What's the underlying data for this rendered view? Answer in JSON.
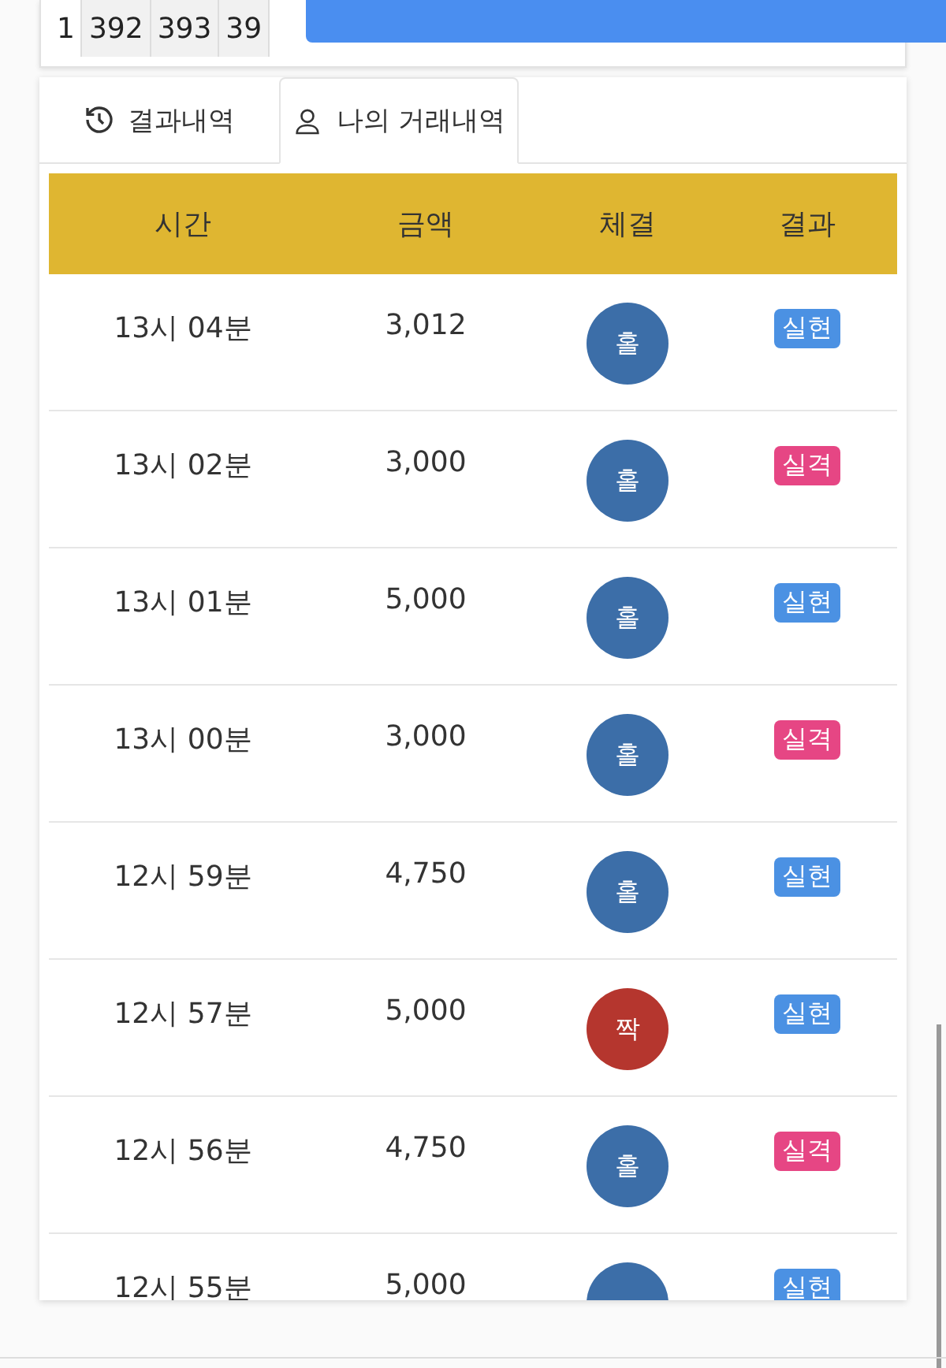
{
  "number_strip": [
    "1",
    "392",
    "393",
    "39"
  ],
  "tabs": [
    {
      "label": "결과내역",
      "selected": false
    },
    {
      "label": "나의 거래내역",
      "selected": true
    }
  ],
  "table": {
    "columns": [
      "시간",
      "금액",
      "체결",
      "결과"
    ],
    "rows": [
      {
        "time": "13시 04분",
        "amount": "3,012",
        "ball": {
          "label": "홀",
          "kind": "odd"
        },
        "result": {
          "label": "실현",
          "kind": "win"
        }
      },
      {
        "time": "13시 02분",
        "amount": "3,000",
        "ball": {
          "label": "홀",
          "kind": "odd"
        },
        "result": {
          "label": "실격",
          "kind": "lose"
        }
      },
      {
        "time": "13시 01분",
        "amount": "5,000",
        "ball": {
          "label": "홀",
          "kind": "odd"
        },
        "result": {
          "label": "실현",
          "kind": "win"
        }
      },
      {
        "time": "13시 00분",
        "amount": "3,000",
        "ball": {
          "label": "홀",
          "kind": "odd"
        },
        "result": {
          "label": "실격",
          "kind": "lose"
        }
      },
      {
        "time": "12시 59분",
        "amount": "4,750",
        "ball": {
          "label": "홀",
          "kind": "odd"
        },
        "result": {
          "label": "실현",
          "kind": "win"
        }
      },
      {
        "time": "12시 57분",
        "amount": "5,000",
        "ball": {
          "label": "짝",
          "kind": "even"
        },
        "result": {
          "label": "실현",
          "kind": "win"
        }
      },
      {
        "time": "12시 56분",
        "amount": "4,750",
        "ball": {
          "label": "홀",
          "kind": "odd"
        },
        "result": {
          "label": "실격",
          "kind": "lose"
        }
      },
      {
        "time": "12시 55분",
        "amount": "5,000",
        "ball": {
          "kind": "odd"
        },
        "result": {
          "label": "실현",
          "kind": "win"
        }
      }
    ]
  }
}
